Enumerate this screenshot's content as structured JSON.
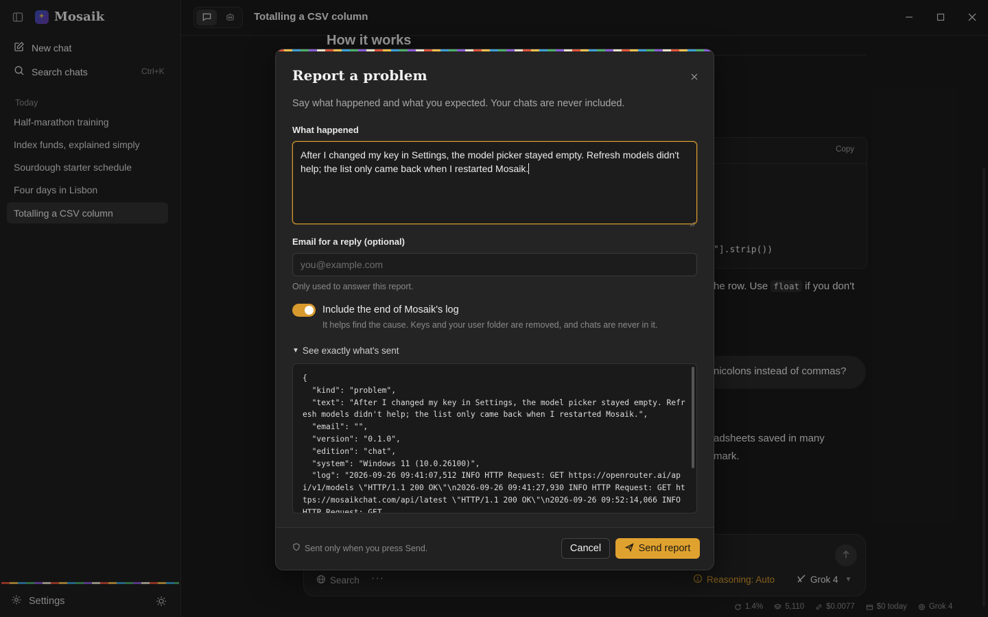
{
  "app": {
    "name": "Mosaik"
  },
  "sidebar": {
    "new_chat": "New chat",
    "search_chats": "Search chats",
    "search_shortcut": "Ctrl+K",
    "section_label": "Today",
    "chats": [
      {
        "title": "Half-marathon training",
        "active": false
      },
      {
        "title": "Index funds, explained simply",
        "active": false
      },
      {
        "title": "Sourdough starter schedule",
        "active": false
      },
      {
        "title": "Four days in Lisbon",
        "active": false
      },
      {
        "title": "Totalling a CSV column",
        "active": true
      }
    ],
    "settings": "Settings"
  },
  "topbar": {
    "title": "Totalling a CSV column"
  },
  "background_chat": {
    "heading": "How it works",
    "copy_label": "Copy",
    "code_tail": "\"].strip())",
    "para1_before": "he row. Use ",
    "para1_code": "float",
    "para1_after": " if you don't",
    "user_message_fragment": "nicolons instead of commas?",
    "para2_line1": "adsheets saved in many",
    "para2_line2": "mark."
  },
  "composer": {
    "search_label": "Search",
    "more_label": "···",
    "reasoning_label": "Reasoning: Auto",
    "model_label": "Grok 4"
  },
  "status": {
    "cpu": "1.4%",
    "tokens": "5,110",
    "cost": "$0.0077",
    "today": "$0 today",
    "model": "Grok 4"
  },
  "dialog": {
    "title": "Report a problem",
    "subtitle": "Say what happened and what you expected. Your chats are never included.",
    "what_label": "What happened",
    "what_value": "After I changed my key in Settings, the model picker stayed empty. Refresh models didn't help; the list only came back when I restarted Mosaik.",
    "email_label": "Email for a reply (optional)",
    "email_placeholder": "you@example.com",
    "email_value": "",
    "email_hint": "Only used to answer this report.",
    "log_toggle_label": "Include the end of Mosaik's log",
    "log_toggle_on": true,
    "log_toggle_help": "It helps find the cause. Keys and your user folder are removed, and chats are never in it.",
    "details_label": "See exactly what's sent",
    "payload_text": "{\n  \"kind\": \"problem\",\n  \"text\": \"After I changed my key in Settings, the model picker stayed empty. Refresh models didn't help; the list only came back when I restarted Mosaik.\",\n  \"email\": \"\",\n  \"version\": \"0.1.0\",\n  \"edition\": \"chat\",\n  \"system\": \"Windows 11 (10.0.26100)\",\n  \"log\": \"2026-09-26 09:41:07,512 INFO HTTP Request: GET https://openrouter.ai/api/v1/models \\\"HTTP/1.1 200 OK\\\"\\n2026-09-26 09:41:27,930 INFO HTTP Request: GET https://mosaikchat.com/api/latest \\\"HTTP/1.1 200 OK\\\"\\n2026-09-26 09:52:14,066 INFO HTTP Request: GET",
    "footer_note": "Sent only when you press Send.",
    "cancel_label": "Cancel",
    "send_label": "Send report"
  }
}
